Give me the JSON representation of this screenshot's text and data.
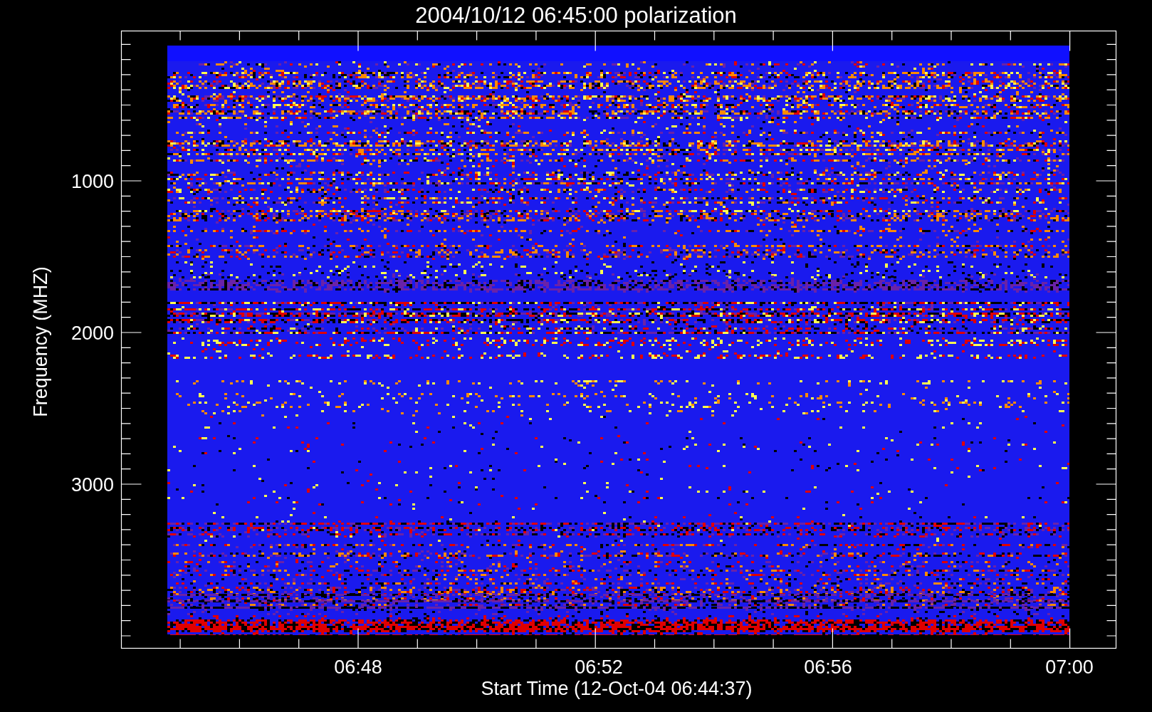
{
  "title": "2004/10/12 06:45:00 polarization",
  "y_axis": {
    "title": "Frequency (MHZ)",
    "tick_labels": [
      "1000",
      "2000",
      "3000"
    ]
  },
  "x_axis": {
    "title": "Start Time (12-Oct-04 06:44:37)",
    "tick_labels": [
      "06:48",
      "06:52",
      "06:56",
      "07:00"
    ]
  }
}
